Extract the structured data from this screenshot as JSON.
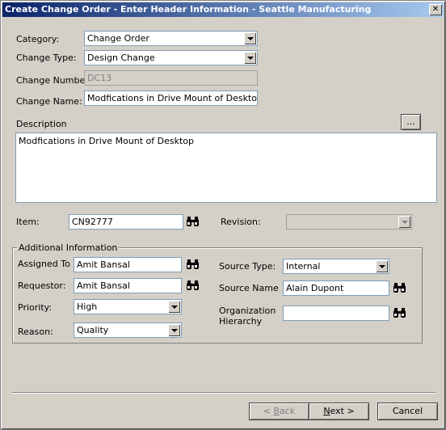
{
  "window": {
    "title": "Create Change Order - Enter Header Information - Seattle Manufacturing",
    "close_glyph": "✕"
  },
  "form": {
    "category": {
      "label": "Category:",
      "value": "Change Order"
    },
    "change_type": {
      "label": "Change Type:",
      "value": "Design Change"
    },
    "change_number": {
      "label": "Change Number:",
      "value": "DC13"
    },
    "change_name": {
      "label": "Change Name:",
      "value": "Modfications in Drive Mount of Desktop"
    },
    "description": {
      "label": "Description",
      "ellipsis": "...",
      "value": "Modfications in Drive Mount of Desktop"
    },
    "item": {
      "label": "Item:",
      "value": "CN92777"
    },
    "revision": {
      "label": "Revision:",
      "value": ""
    }
  },
  "additional": {
    "title": "Additional Information",
    "assigned_to": {
      "label": "Assigned To",
      "value": "Amit Bansal"
    },
    "requestor": {
      "label": "Requestor:",
      "value": "Amit Bansal"
    },
    "priority": {
      "label": "Priority:",
      "value": "High"
    },
    "reason": {
      "label": "Reason:",
      "value": "Quality"
    },
    "source_type": {
      "label": "Source Type:",
      "value": "Internal"
    },
    "source_name": {
      "label": "Source Name",
      "value": "Alain Dupont"
    },
    "org_hierarchy": {
      "label_line1": "Organization",
      "label_line2": "Hierarchy",
      "value": ""
    }
  },
  "buttons": {
    "back": {
      "prefix": "< ",
      "key": "B",
      "rest": "ack"
    },
    "next": {
      "key": "N",
      "rest": "ext >"
    },
    "cancel": "Cancel"
  },
  "icons": {
    "binoculars": "binoculars-icon",
    "dropdown": "chevron-down-icon"
  }
}
